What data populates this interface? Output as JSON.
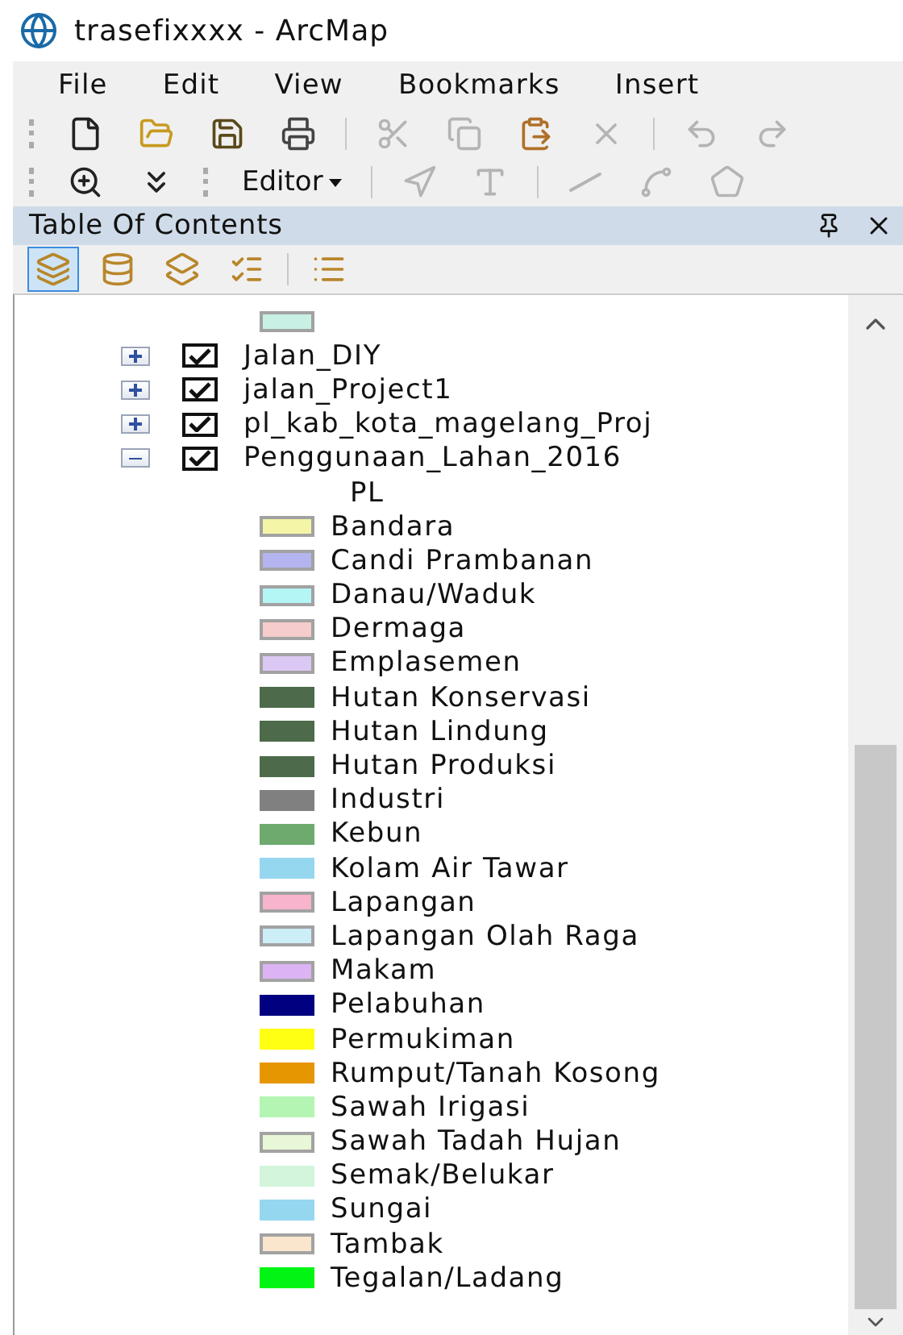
{
  "window": {
    "title": "trasefixxxx - ArcMap"
  },
  "menu": [
    "File",
    "Edit",
    "View",
    "Bookmarks",
    "Insert"
  ],
  "toolbars": [
    {
      "items": [
        {
          "kind": "new",
          "disabled": false
        },
        {
          "kind": "open",
          "disabled": false
        },
        {
          "kind": "save",
          "disabled": false
        },
        {
          "kind": "print",
          "disabled": false
        },
        {
          "kind": "separator"
        },
        {
          "kind": "cut",
          "disabled": true
        },
        {
          "kind": "copy",
          "disabled": true
        },
        {
          "kind": "paste",
          "disabled": false
        },
        {
          "kind": "delete",
          "disabled": true
        },
        {
          "kind": "separator"
        },
        {
          "kind": "undo",
          "disabled": true
        },
        {
          "kind": "redo",
          "disabled": true
        }
      ]
    },
    {
      "items": [
        {
          "kind": "zoom",
          "disabled": false
        },
        {
          "kind": "overflow",
          "disabled": false
        },
        {
          "kind": "grip"
        },
        {
          "kind": "dropdown",
          "label": "Editor",
          "disabled": false
        },
        {
          "kind": "separator"
        },
        {
          "kind": "edit-tool",
          "disabled": true
        },
        {
          "kind": "annotate",
          "disabled": true
        },
        {
          "kind": "separator"
        },
        {
          "kind": "line",
          "disabled": true
        },
        {
          "kind": "polyline",
          "disabled": true
        },
        {
          "kind": "polygon",
          "disabled": true
        }
      ]
    }
  ],
  "toc": {
    "title": "Table Of Contents",
    "views": [
      {
        "kind": "drawing-order",
        "selected": true
      },
      {
        "kind": "source",
        "selected": false
      },
      {
        "kind": "visibility",
        "selected": false
      },
      {
        "kind": "selection",
        "selected": false
      },
      {
        "kind": "separator"
      },
      {
        "kind": "options",
        "selected": false
      }
    ],
    "top_swatch": {
      "color": "#c8f0e4",
      "outlined": true
    },
    "layers": [
      {
        "name": "Jalan_DIY",
        "expanded": false,
        "checked": true
      },
      {
        "name": "jalan_Project1",
        "expanded": false,
        "checked": true
      },
      {
        "name": "pl_kab_kota_magelang_Proj",
        "expanded": false,
        "checked": true
      },
      {
        "name": "Penggunaan_Lahan_2016",
        "expanded": true,
        "checked": true,
        "field": "PL",
        "children": [
          {
            "name": "Bandara",
            "color": "#f5f5a8",
            "outlined": true
          },
          {
            "name": "Candi Prambanan",
            "color": "#b4b4f0",
            "outlined": true
          },
          {
            "name": "Danau/Waduk",
            "color": "#b4f5f5",
            "outlined": true
          },
          {
            "name": "Dermaga",
            "color": "#f7cccc",
            "outlined": true
          },
          {
            "name": "Emplasemen",
            "color": "#dcc8f5",
            "outlined": true
          },
          {
            "name": "Hutan Konservasi",
            "color": "#4d6b4a",
            "outlined": false
          },
          {
            "name": "Hutan Lindung",
            "color": "#4d6b4a",
            "outlined": false
          },
          {
            "name": "Hutan Produksi",
            "color": "#4d6b4a",
            "outlined": false
          },
          {
            "name": "Industri",
            "color": "#808080",
            "outlined": false
          },
          {
            "name": "Kebun",
            "color": "#6eaa6e",
            "outlined": false
          },
          {
            "name": "Kolam Air Tawar",
            "color": "#96d7f0",
            "outlined": false
          },
          {
            "name": "Lapangan",
            "color": "#f7b4cc",
            "outlined": true
          },
          {
            "name": "Lapangan Olah Raga",
            "color": "#cceef7",
            "outlined": true
          },
          {
            "name": "Makam",
            "color": "#dcb4f5",
            "outlined": true
          },
          {
            "name": "Pelabuhan",
            "color": "#000080",
            "outlined": false
          },
          {
            "name": "Permukiman",
            "color": "#ffff14",
            "outlined": false
          },
          {
            "name": "Rumput/Tanah Kosong",
            "color": "#e69600",
            "outlined": false
          },
          {
            "name": "Sawah Irigasi",
            "color": "#b4f5b4",
            "outlined": false
          },
          {
            "name": "Sawah Tadah Hujan",
            "color": "#e8f7d7",
            "outlined": true
          },
          {
            "name": "Semak/Belukar",
            "color": "#d2f5dc",
            "outlined": false
          },
          {
            "name": "Sungai",
            "color": "#96d7f0",
            "outlined": false
          },
          {
            "name": "Tambak",
            "color": "#fae6cd",
            "outlined": true
          },
          {
            "name": "Tegalan/Ladang",
            "color": "#00f514",
            "outlined": false
          }
        ]
      }
    ]
  }
}
